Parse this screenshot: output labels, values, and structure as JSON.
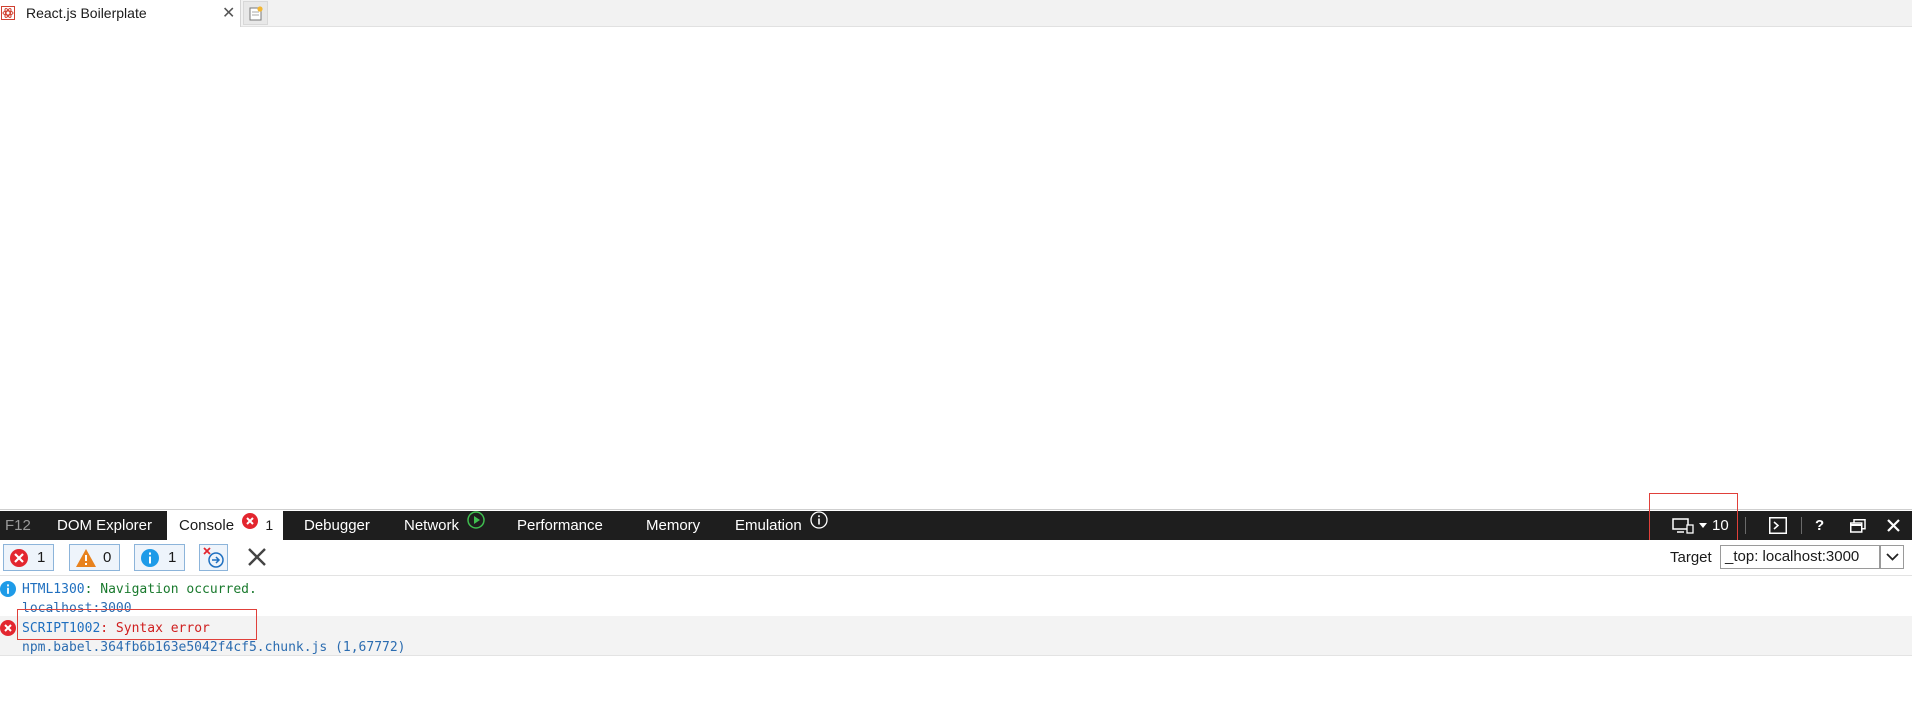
{
  "browser": {
    "tab": {
      "title": "React.js Boilerplate",
      "close_glyph": "✕"
    }
  },
  "devtools": {
    "tabs": {
      "f12": "F12",
      "dom_explorer": "DOM Explorer",
      "console": "Console",
      "console_error_count": "1",
      "debugger": "Debugger",
      "network": "Network",
      "performance": "Performance",
      "memory": "Memory",
      "emulation": "Emulation"
    },
    "document_mode": "10",
    "filters": {
      "errors": "1",
      "warnings": "0",
      "messages": "1"
    },
    "target": {
      "label": "Target",
      "value": "_top: localhost:3000"
    },
    "messages": [
      {
        "type": "info",
        "code": "HTML1300",
        "text": ": Navigation occurred.",
        "source": "localhost:3000"
      },
      {
        "type": "error",
        "code": "SCRIPT1002",
        "text": ": Syntax error",
        "source": "npm.babel.364fb6b163e5042f4cf5.chunk.js (1,67772)"
      }
    ]
  }
}
